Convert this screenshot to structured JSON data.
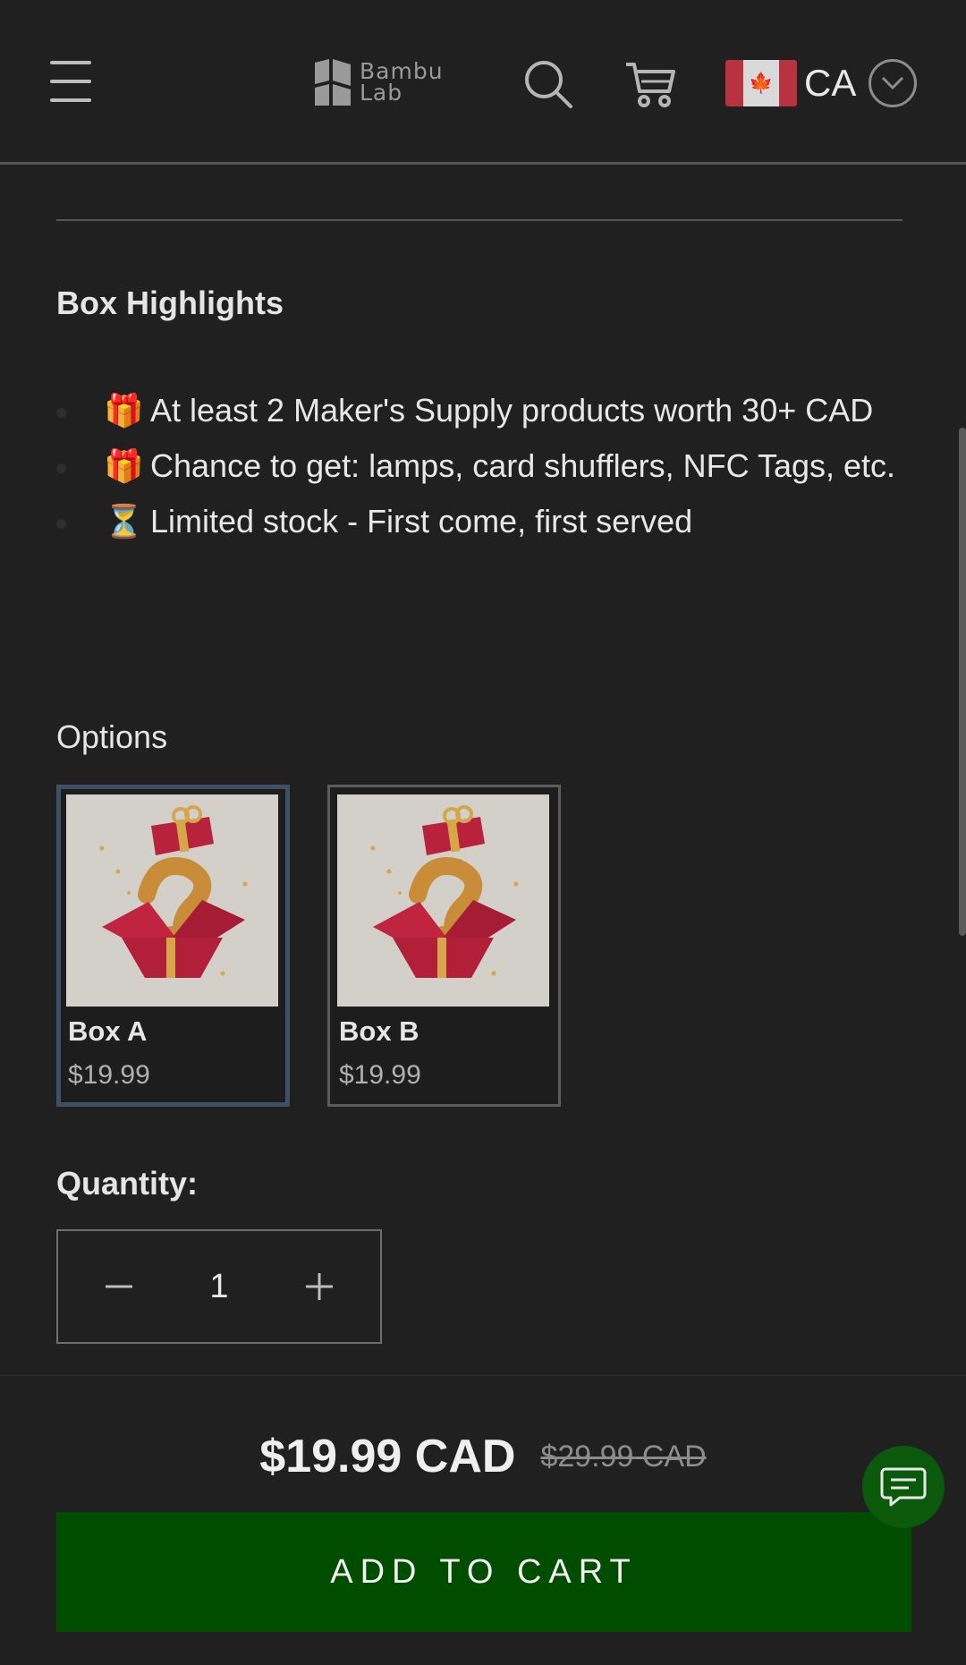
{
  "header": {
    "logo_text": "Bambu\nLab",
    "country_code": "CA",
    "flag_leaf": "🍁"
  },
  "box_highlights": {
    "title": "Box Highlights",
    "items": [
      {
        "emoji": "🎁",
        "text": "At least 2 Maker's Supply products worth 30+ CAD"
      },
      {
        "emoji": "🎁",
        "text": "Chance to get: lamps, card shufflers, NFC Tags, etc."
      },
      {
        "emoji": "⏳",
        "text": "Limited stock - First come, first served"
      }
    ]
  },
  "options": {
    "title": "Options",
    "items": [
      {
        "name": "Box A",
        "price": "$19.99",
        "selected": true
      },
      {
        "name": "Box B",
        "price": "$19.99",
        "selected": false
      }
    ]
  },
  "quantity": {
    "label": "Quantity:",
    "value": "1"
  },
  "purchase": {
    "price": "$19.99 CAD",
    "compare_price": "$29.99 CAD",
    "add_to_cart": "ADD TO CART"
  },
  "colors": {
    "background": "#202020",
    "button_green": "#004d00",
    "chat_green": "#0b5a0b",
    "selected_border": "#3e5068"
  }
}
